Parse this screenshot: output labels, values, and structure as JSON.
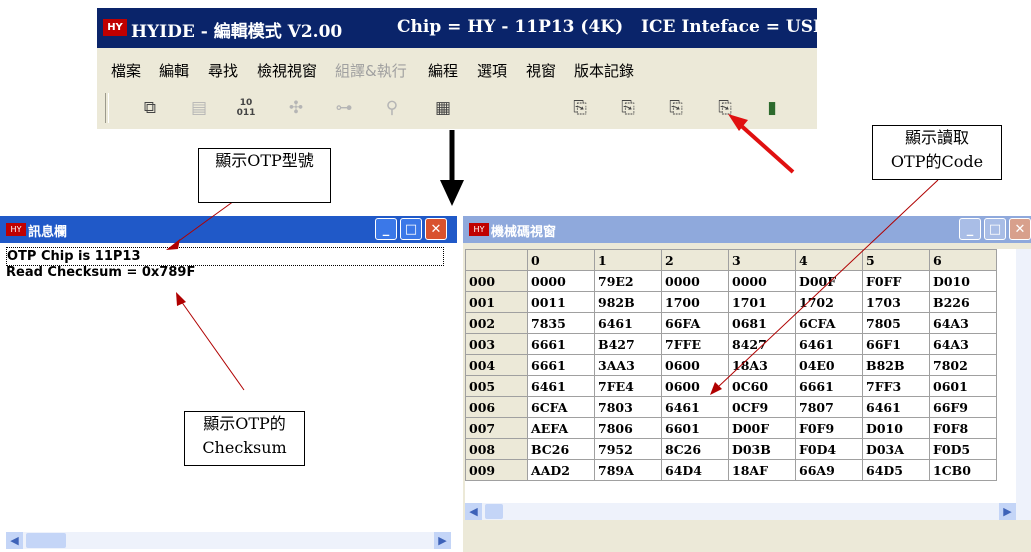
{
  "ide": {
    "logo": "HYCON",
    "title": "HYIDE - 編輯模式 V2.00",
    "chip": "Chip = HY - 11P13  (4K)",
    "ice": "ICE Inteface = USB",
    "menu": [
      "檔案",
      "編輯",
      "尋找",
      "檢視視窗",
      "組譯&執行",
      "編程",
      "選項",
      "視窗",
      "版本記錄"
    ],
    "toolbar_icons": [
      "copy-icon",
      "list-icon",
      "binary-icon",
      "build-icon",
      "link-icon",
      "debug-icon",
      "memory-icon",
      "otp-blank-check-icon",
      "otp-program-icon",
      "otp-verify-icon",
      "otp-read-code-icon",
      "stop-light-icon"
    ],
    "toolbar_glyphs": {
      "bin": "10\n011"
    }
  },
  "msg_window": {
    "title": "訊息欄",
    "lines": [
      "OTP Chip is 11P13",
      "Read Checksum = 0x789F"
    ]
  },
  "code_window": {
    "title": "機械碼視窗",
    "columns": [
      "0",
      "1",
      "2",
      "3",
      "4",
      "5",
      "6"
    ],
    "rows": [
      {
        "addr": "000",
        "cells": [
          "0000",
          "79E2",
          "0000",
          "0000",
          "D00F",
          "F0FF",
          "D010"
        ]
      },
      {
        "addr": "001",
        "cells": [
          "0011",
          "982B",
          "1700",
          "1701",
          "1702",
          "1703",
          "B226"
        ]
      },
      {
        "addr": "002",
        "cells": [
          "7835",
          "6461",
          "66FA",
          "0681",
          "6CFA",
          "7805",
          "64A3"
        ]
      },
      {
        "addr": "003",
        "cells": [
          "6661",
          "B427",
          "7FFE",
          "8427",
          "6461",
          "66F1",
          "64A3"
        ]
      },
      {
        "addr": "004",
        "cells": [
          "6661",
          "3AA3",
          "0600",
          "18A3",
          "04E0",
          "B82B",
          "7802"
        ]
      },
      {
        "addr": "005",
        "cells": [
          "6461",
          "7FE4",
          "0600",
          "0C60",
          "6661",
          "7FF3",
          "0601"
        ]
      },
      {
        "addr": "006",
        "cells": [
          "6CFA",
          "7803",
          "6461",
          "0CF9",
          "7807",
          "6461",
          "66F9"
        ]
      },
      {
        "addr": "007",
        "cells": [
          "AEFA",
          "7806",
          "6601",
          "D00F",
          "F0F9",
          "D010",
          "F0F8"
        ]
      },
      {
        "addr": "008",
        "cells": [
          "BC26",
          "7952",
          "8C26",
          "D03B",
          "F0D4",
          "D03A",
          "F0D5"
        ]
      },
      {
        "addr": "009",
        "cells": [
          "AAD2",
          "789A",
          "64D4",
          "18AF",
          "66A9",
          "64D5",
          "1CB0"
        ]
      }
    ]
  },
  "callouts": {
    "otp_model": "顯示OTP型號",
    "otp_checksum_1": "顯示OTP的",
    "otp_checksum_2": "Checksum",
    "read_code_1": "顯示讀取",
    "read_code_2": "OTP的Code"
  },
  "colors": {
    "titlebar": "#2059c8",
    "ide_titlebar": "#0a246a",
    "red_arrow": "#e01010"
  }
}
